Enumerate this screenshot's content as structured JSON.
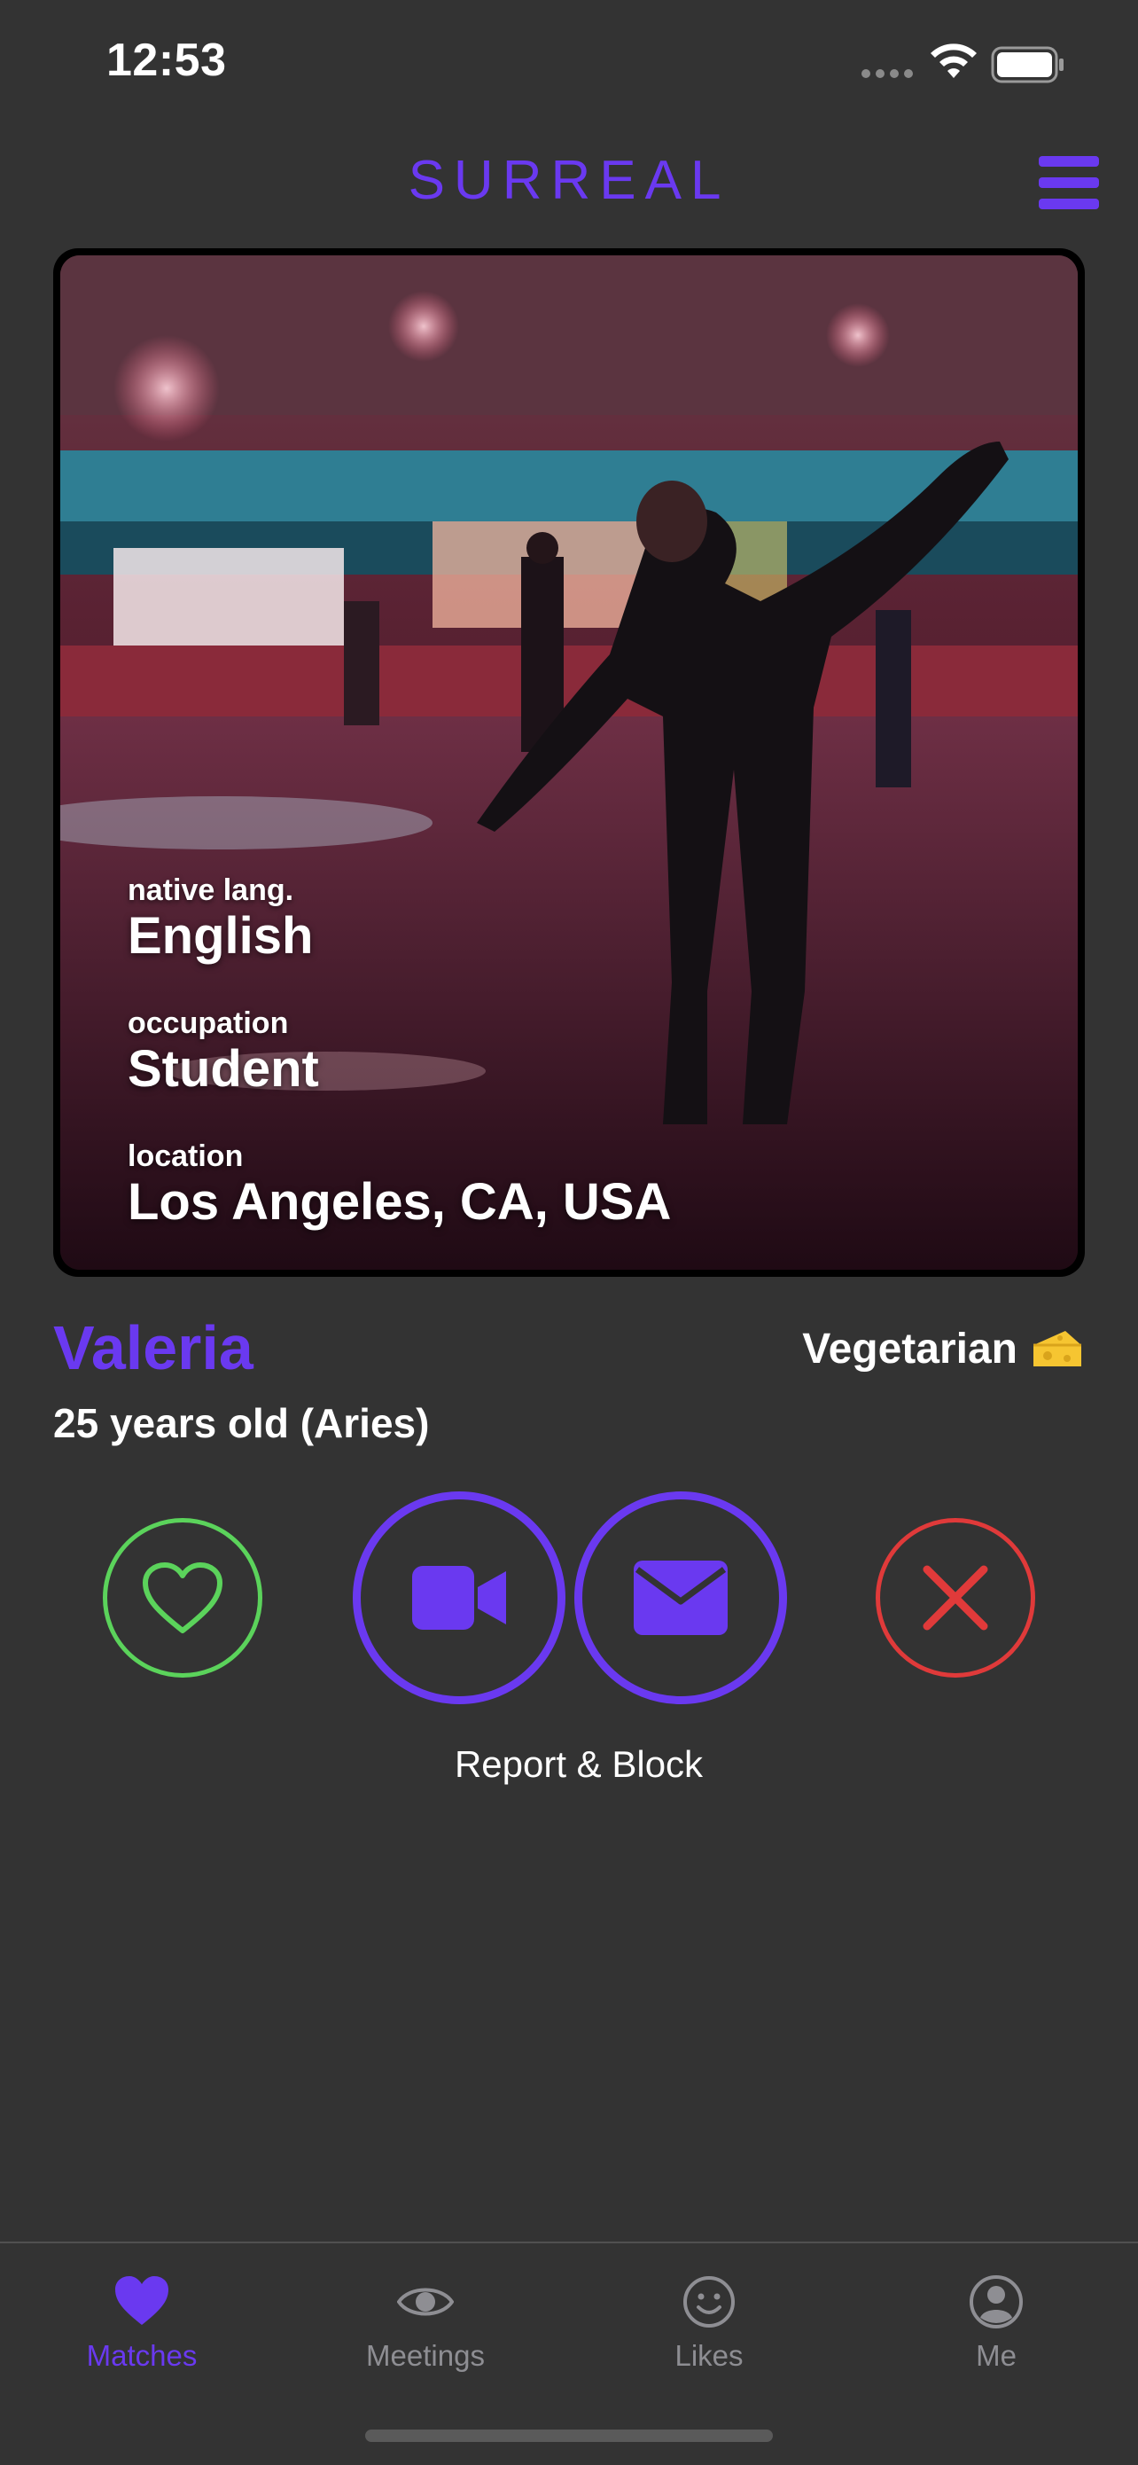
{
  "status_bar": {
    "time": "12:53"
  },
  "header": {
    "title": "SURREAL"
  },
  "profile": {
    "photo_alt": "Woman roller skating",
    "details": [
      {
        "label": "native lang.",
        "value": "English"
      },
      {
        "label": "occupation",
        "value": "Student"
      },
      {
        "label": "location",
        "value": "Los Angeles, CA, USA"
      }
    ],
    "name": "Valeria",
    "age_line": "25 years old (Aries)",
    "diet": "Vegetarian"
  },
  "actions": {
    "report_label": "Report & Block"
  },
  "tabs": [
    {
      "label": "Matches",
      "icon": "heart-icon",
      "active": true
    },
    {
      "label": "Meetings",
      "icon": "eye-icon",
      "active": false
    },
    {
      "label": "Likes",
      "icon": "smiley-icon",
      "active": false
    },
    {
      "label": "Me",
      "icon": "person-circle-icon",
      "active": false
    }
  ],
  "colors": {
    "background": "#333333",
    "accent": "#6a39f0",
    "like": "#5bd35b",
    "dismiss": "#e03a3a",
    "tab_inactive": "#8e8e93"
  }
}
